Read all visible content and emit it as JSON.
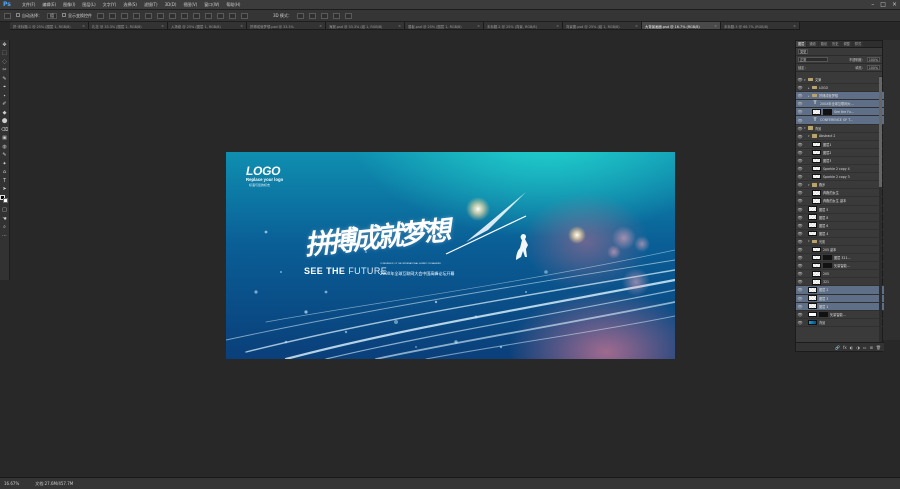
{
  "app": {
    "logo": "Ps"
  },
  "menu": [
    "文件(F)",
    "编辑(E)",
    "图像(I)",
    "图层(L)",
    "文字(Y)",
    "选择(S)",
    "滤镜(T)",
    "3D(D)",
    "视图(V)",
    "窗口(W)",
    "帮助(H)"
  ],
  "window_controls": {
    "minimize": "–",
    "maximize": "□",
    "close": "×"
  },
  "options": {
    "auto_select_label": "自动选择：",
    "auto_select_value": "组",
    "show_transform": "显示变换控件",
    "mode_3d": "3D 模式："
  },
  "tabs": [
    {
      "label": "拼·未标题-1 @ 25% (图层 1, RGB/8)",
      "active": false
    },
    {
      "label": "礼花 @ 33.3% (图层 1, RGB/8)",
      "active": false
    },
    {
      "label": "入场卷 @ 25% (图层 1, RGB/8)",
      "active": false
    },
    {
      "label": "拼搏成就梦想.psd @ 33.3%",
      "active": false
    },
    {
      "label": "海报.psd @ 33.3% (组 1, RGB/8)",
      "active": false
    },
    {
      "label": "展板.psd @ 25% (图层 1, RGB/8)",
      "active": false
    },
    {
      "label": "未标题-2 @ 25% (背景, RGB/8)",
      "active": false
    },
    {
      "label": "背景图.psd @ 25% (组 1, RGB/8)",
      "active": false
    },
    {
      "label": "大背景画面.psd @ 16.7% (RGB/8)",
      "active": true
    },
    {
      "label": "未标题-3 @ 66.7% (RGB/8)",
      "active": false
    }
  ],
  "tools": [
    "✥",
    "⬚",
    "◌",
    "✂",
    "✎",
    "⌖",
    "⬩",
    "✐",
    "◆",
    "⬤",
    "⌫",
    "▣",
    "◍",
    "✎",
    "✦",
    "⌂",
    "T",
    "➤",
    "□",
    "☚",
    "⌕",
    "⋯"
  ],
  "artwork": {
    "logo": "LOGO",
    "replace_logo": "Replace your logo",
    "logo_sub": "标语与您的标志",
    "headline": "拼搏成就梦想",
    "see_the": "SEE THE",
    "future": "FUTURE",
    "conference_en": "CONFERENCE OF THE INTERNATIONAL SUMMIT ON MANKIND",
    "conference_cn": "200X年全球互联网大会中国高峰论坛开幕"
  },
  "status": {
    "zoom": "16.67%",
    "doc": "文档:27.6M/457.7M"
  },
  "panel": {
    "tabs": [
      "图层",
      "通道",
      "路径",
      "历史",
      "调整",
      "样式"
    ],
    "kind_label": "类型",
    "blend_mode": "正常",
    "opacity_label": "不透明度：",
    "opacity_value": "100%",
    "lock_label": "锁定：",
    "fill_label": "填充：",
    "fill_value": "100%",
    "footer_icons": [
      "🔗",
      "fx",
      "◐",
      "◑",
      "▭",
      "⊞",
      "🗑"
    ]
  },
  "layers": [
    {
      "name": "文案",
      "kind": "folder",
      "indent": 0,
      "sel": false,
      "open": true
    },
    {
      "name": "LOGO",
      "kind": "folder",
      "indent": 1,
      "sel": false,
      "open": false
    },
    {
      "name": "拼搏成就梦想",
      "kind": "folder",
      "indent": 1,
      "sel": true,
      "open": false
    },
    {
      "name": "200X年全球互联网大...",
      "kind": "text",
      "indent": 2,
      "sel": true,
      "fx": ""
    },
    {
      "name": "See the Fu...",
      "kind": "mask",
      "indent": 2,
      "sel": true,
      "fx": "fx"
    },
    {
      "name": "CONFERENCE OF T...",
      "kind": "text",
      "indent": 2,
      "sel": true,
      "fx": ""
    },
    {
      "name": "背景",
      "kind": "folder",
      "indent": 0,
      "sel": false,
      "open": true
    },
    {
      "name": "Abstract 2",
      "kind": "folder",
      "indent": 1,
      "sel": false,
      "open": true
    },
    {
      "name": "图层1",
      "kind": "pixel",
      "indent": 2,
      "sel": false,
      "fx": ""
    },
    {
      "name": "图层2",
      "kind": "pixel",
      "indent": 2,
      "sel": false,
      "fx": ""
    },
    {
      "name": "图层3",
      "kind": "pixel",
      "indent": 2,
      "sel": false,
      "fx": ""
    },
    {
      "name": "Sparkle 2 copy 4",
      "kind": "pixel",
      "indent": 2,
      "sel": false,
      "fx": ""
    },
    {
      "name": "Sparkle 2 copy 3",
      "kind": "pixel",
      "indent": 2,
      "sel": false,
      "fx": ""
    },
    {
      "name": "跑步",
      "kind": "folder",
      "indent": 1,
      "sel": false,
      "open": true
    },
    {
      "name": "奔跑的女生",
      "kind": "pixel",
      "indent": 2,
      "sel": false,
      "fx": ""
    },
    {
      "name": "奔跑的女生 副本",
      "kind": "pixel",
      "indent": 2,
      "sel": false,
      "fx": ""
    },
    {
      "name": "图层 5",
      "kind": "pixel",
      "indent": 1,
      "sel": false,
      "fx": ""
    },
    {
      "name": "图层 8",
      "kind": "pixel",
      "indent": 1,
      "sel": false,
      "fx": ""
    },
    {
      "name": "图层 6",
      "kind": "pixel",
      "indent": 1,
      "sel": false,
      "fx": ""
    },
    {
      "name": "图层 4",
      "kind": "pixel",
      "indent": 1,
      "sel": false,
      "fx": ""
    },
    {
      "name": "光影",
      "kind": "folder",
      "indent": 1,
      "sel": false,
      "open": true
    },
    {
      "name": "205 副本",
      "kind": "pixel",
      "indent": 2,
      "sel": false,
      "fx": ""
    },
    {
      "name": "图层 321...",
      "kind": "mask",
      "indent": 2,
      "sel": false,
      "fx": ""
    },
    {
      "name": "矢量智能...",
      "kind": "mask",
      "indent": 2,
      "sel": false,
      "fx": ""
    },
    {
      "name": "205",
      "kind": "pixel",
      "indent": 2,
      "sel": false,
      "fx": ""
    },
    {
      "name": "321",
      "kind": "pixel",
      "indent": 2,
      "sel": false,
      "fx": ""
    },
    {
      "name": "图层 2",
      "kind": "pixel",
      "indent": 1,
      "sel": true,
      "fx": "fx"
    },
    {
      "name": "图层 3",
      "kind": "pixel",
      "indent": 1,
      "sel": true,
      "fx": "fx"
    },
    {
      "name": "图层 1",
      "kind": "pixel",
      "indent": 1,
      "sel": true,
      "fx": "fx"
    },
    {
      "name": "矢量智能...",
      "kind": "black",
      "indent": 1,
      "sel": false,
      "fx": ""
    },
    {
      "name": "背景",
      "kind": "blue",
      "indent": 1,
      "sel": false,
      "fx": ""
    }
  ]
}
